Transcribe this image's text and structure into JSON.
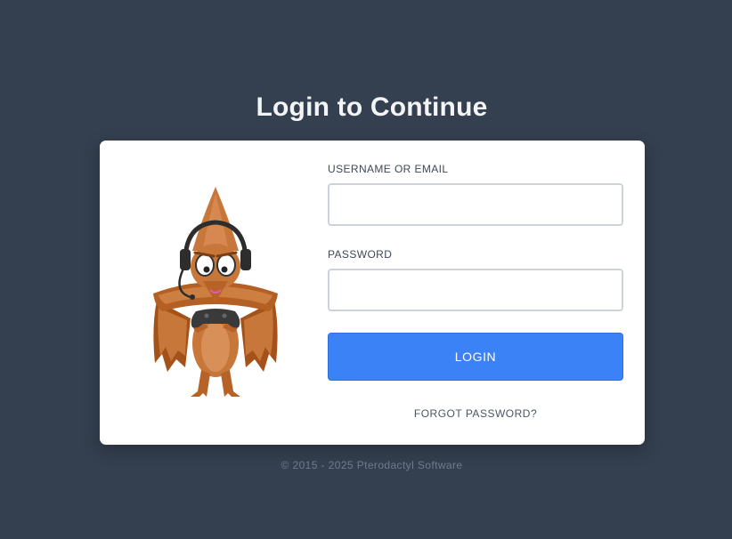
{
  "page": {
    "title": "Login to Continue",
    "background_color": "#343f4f"
  },
  "form": {
    "username_label": "USERNAME OR EMAIL",
    "username_value": "",
    "password_label": "PASSWORD",
    "password_value": "",
    "login_button": "LOGIN",
    "forgot_link": "FORGOT PASSWORD?",
    "accent_color": "#3b82f6"
  },
  "mascot": {
    "icon": "pterodactyl-gamer-mascot"
  },
  "footer": {
    "copyright": "© 2015 - 2025 Pterodactyl Software"
  }
}
